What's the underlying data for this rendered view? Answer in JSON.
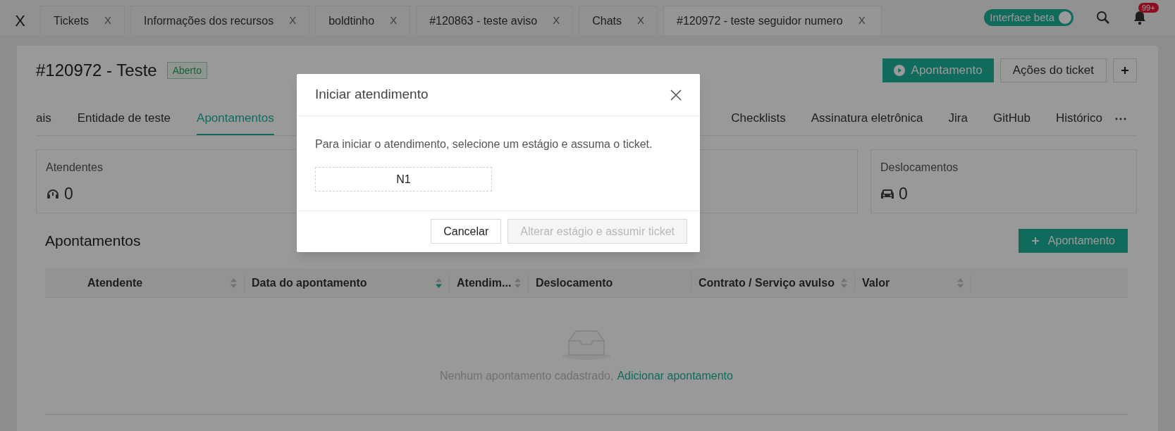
{
  "open_tabs": {
    "close_all": "X",
    "tabs": [
      {
        "label": "Tickets",
        "close": "X",
        "selected": false
      },
      {
        "label": "Informações dos recursos",
        "close": "X",
        "selected": false
      },
      {
        "label": "boldtinho",
        "close": "X",
        "selected": false
      },
      {
        "label": "#120863 - teste aviso",
        "close": "X",
        "selected": false
      },
      {
        "label": "Chats",
        "close": "X",
        "selected": false
      },
      {
        "label": "#120972 - teste seguidor numero",
        "close": "X",
        "selected": true
      }
    ]
  },
  "beta_toggle": {
    "label": "Interface beta",
    "on": true
  },
  "notifications": {
    "badge": "99+"
  },
  "ticket": {
    "title": "#120972 - Teste",
    "status": "Aberto"
  },
  "actions": [
    {
      "kind": "primary",
      "label": "Apontamento"
    },
    {
      "kind": "default",
      "label": "Ações do ticket"
    },
    {
      "kind": "more"
    }
  ],
  "section_tabs": {
    "left": [
      {
        "label": "ais",
        "selected": false
      },
      {
        "label": "Entidade de teste",
        "selected": false
      },
      {
        "label": "Apontamentos",
        "selected": true
      }
    ],
    "right": [
      {
        "label": "Checklists",
        "selected": false
      },
      {
        "label": "Assinatura eletrônica",
        "selected": false
      },
      {
        "label": "Jira",
        "selected": false
      },
      {
        "label": "GitHub",
        "selected": false
      },
      {
        "label": "Histórico",
        "selected": false
      }
    ]
  },
  "summary_cards": [
    {
      "kind": "attendants",
      "title": "Atendentes",
      "value": "0"
    },
    {
      "kind": "travel",
      "title": "Deslocamentos",
      "value": "0"
    }
  ],
  "appointments": {
    "title": "Apontamentos",
    "add_button": "Apontamento",
    "table": {
      "columns": [
        {
          "label": "Atendente",
          "sortable": true,
          "sorted": false
        },
        {
          "label": "Data do apontamento",
          "sortable": true,
          "sorted": true
        },
        {
          "label": "Atendim...",
          "sortable": true,
          "sorted": false
        },
        {
          "label": "Deslocamento",
          "sortable": false
        },
        {
          "label": "Contrato / Serviço avulso",
          "sortable": true,
          "sorted": false
        },
        {
          "label": "Valor",
          "sortable": true,
          "sorted": false
        }
      ],
      "empty": {
        "text": "Nenhum apontamento cadastrado,",
        "link": "Adicionar apontamento"
      }
    }
  },
  "modal": {
    "title": "Iniciar atendimento",
    "message": "Para iniciar o atendimento, selecione um estágio e assuma o ticket.",
    "stages": [
      {
        "label": "N1",
        "selected": false
      }
    ],
    "buttons": [
      {
        "label": "Cancelar",
        "disabled": false
      },
      {
        "label": "Alterar estágio e assumir ticket",
        "disabled": true
      }
    ]
  }
}
